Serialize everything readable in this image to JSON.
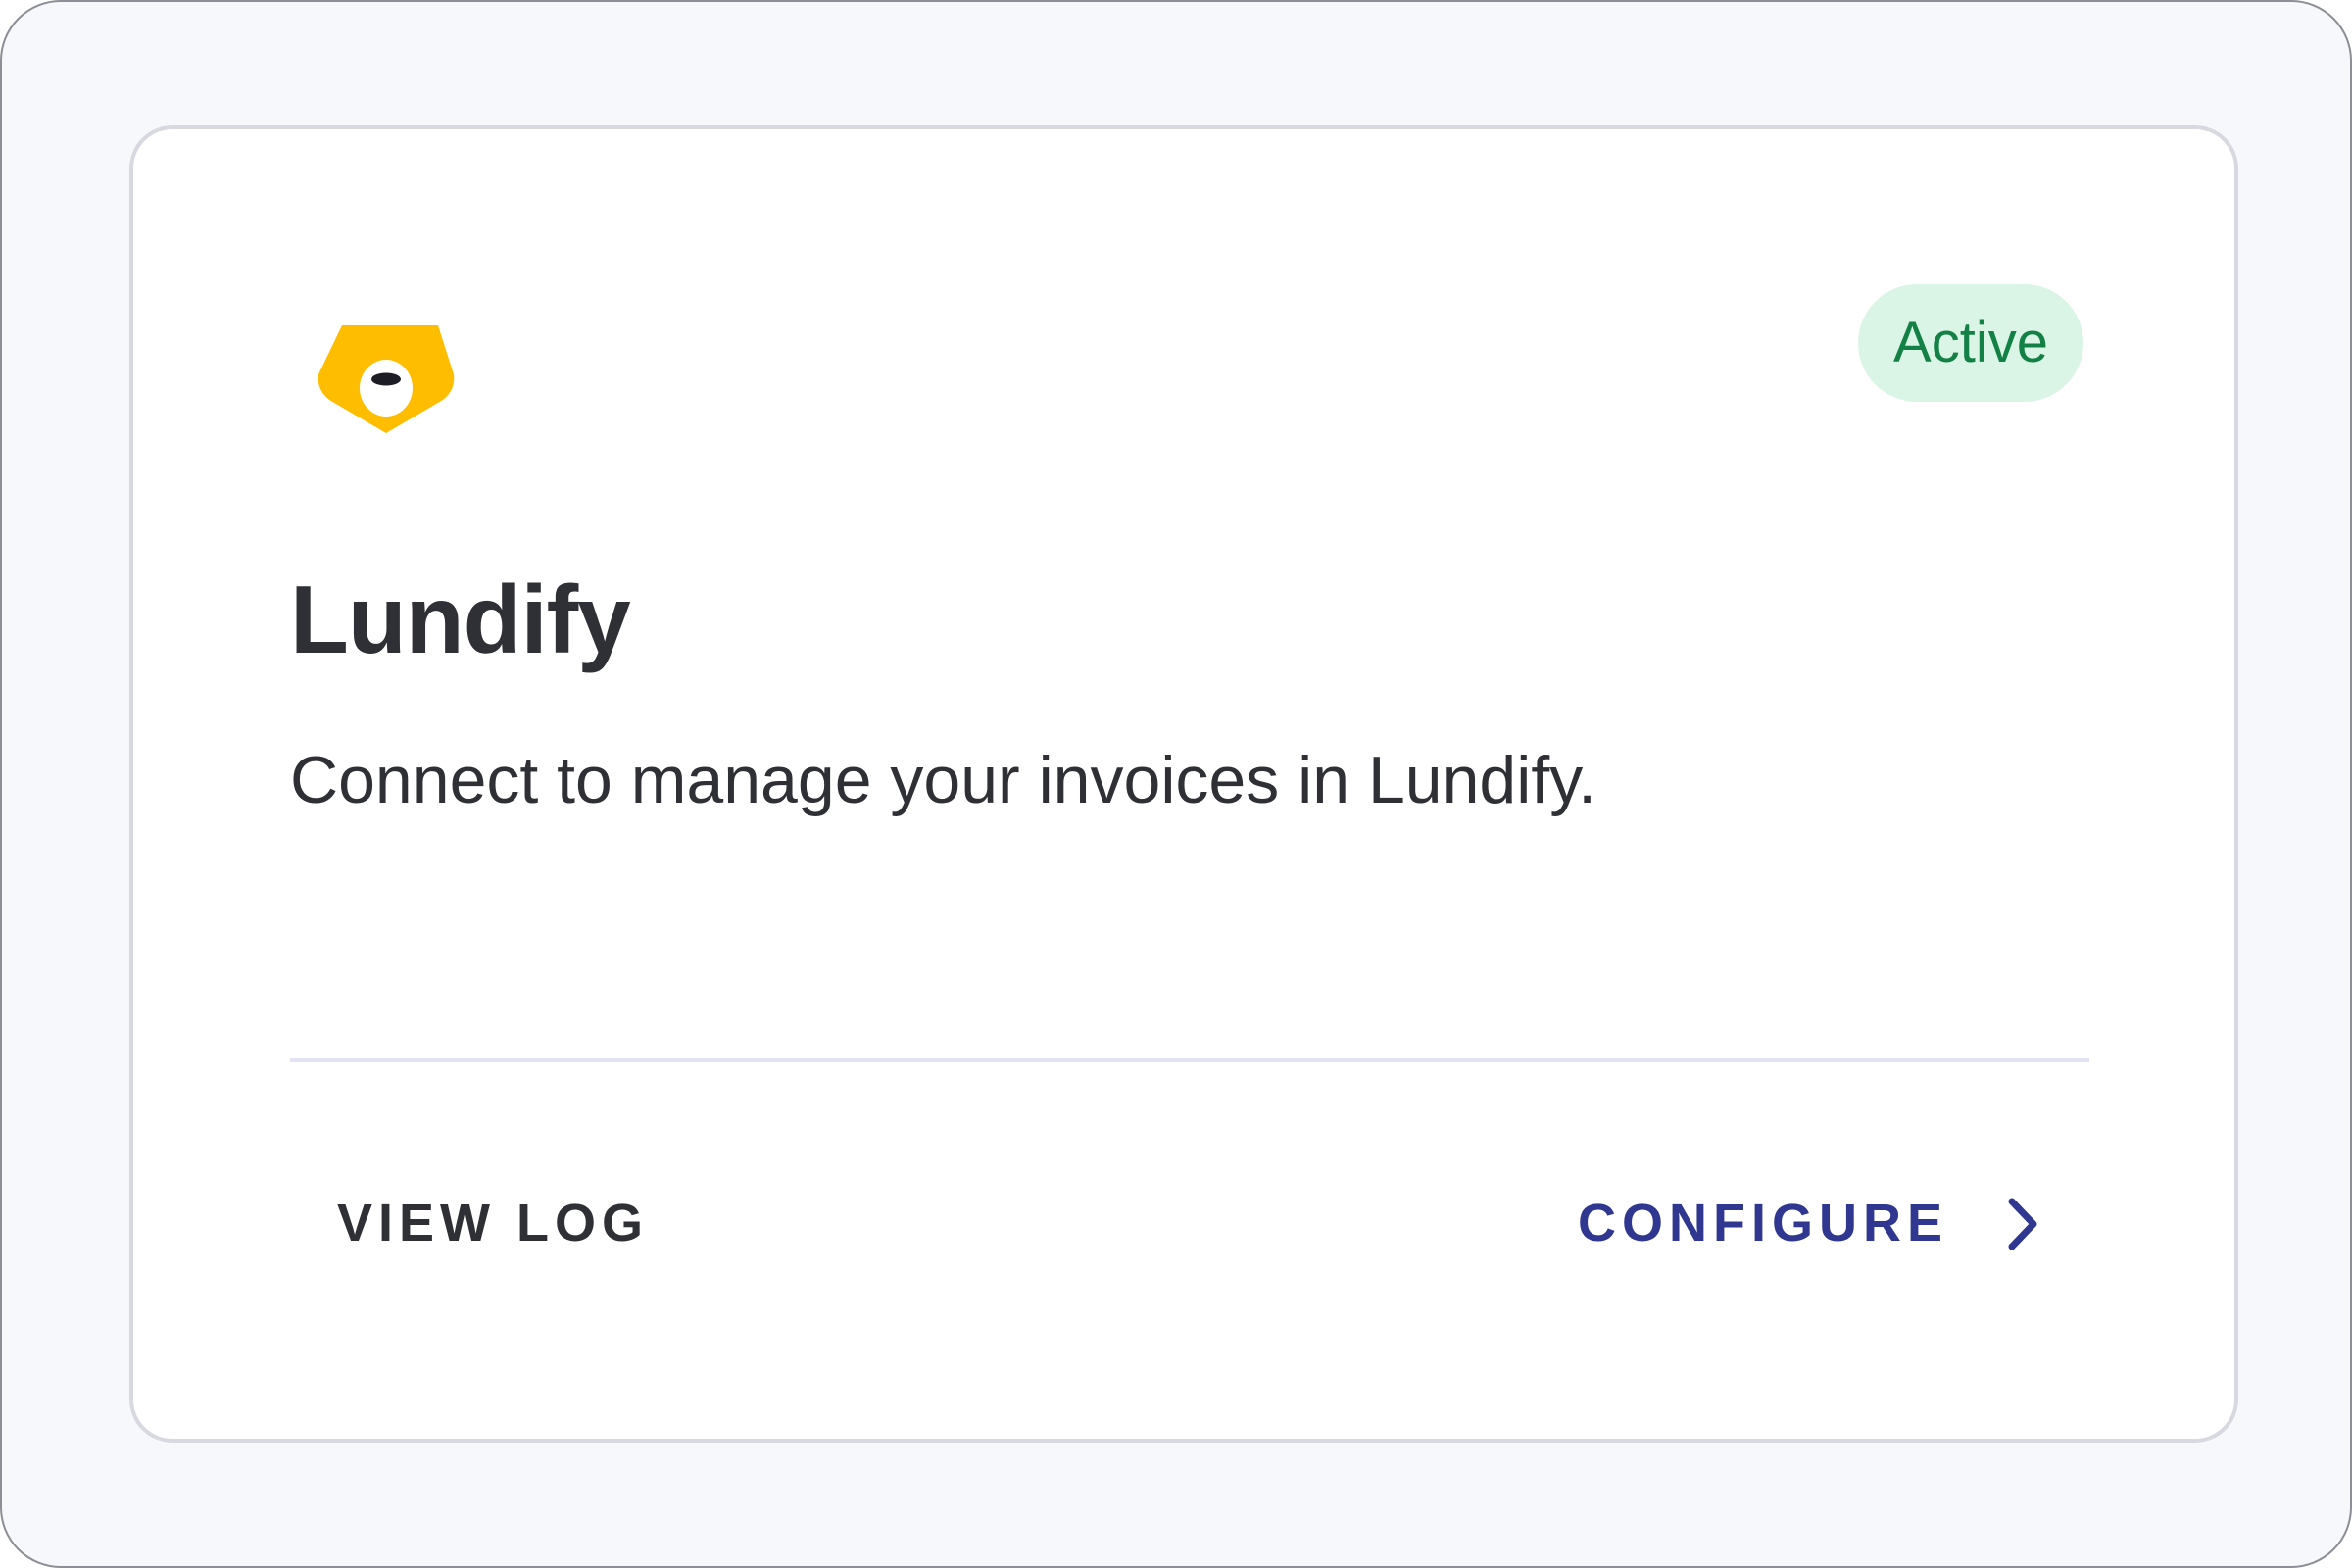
{
  "integration": {
    "name": "Lundify",
    "description": "Connect to manage your invoices in Lundify.",
    "status": "Active",
    "logo_icon": "lundify-logo-icon"
  },
  "actions": {
    "view_log_label": "VIEW LOG",
    "configure_label": "CONFIGURE",
    "configure_icon": "chevron-right-icon"
  },
  "colors": {
    "page_background": "#f7f8fc",
    "card_background": "#ffffff",
    "card_border": "#d8d9e0",
    "logo": "#ffbd00",
    "status_background": "#daf5e6",
    "status_text": "#138046",
    "primary_action": "#2f3790",
    "text": "#2f3035",
    "divider": "#e3e2f2"
  }
}
